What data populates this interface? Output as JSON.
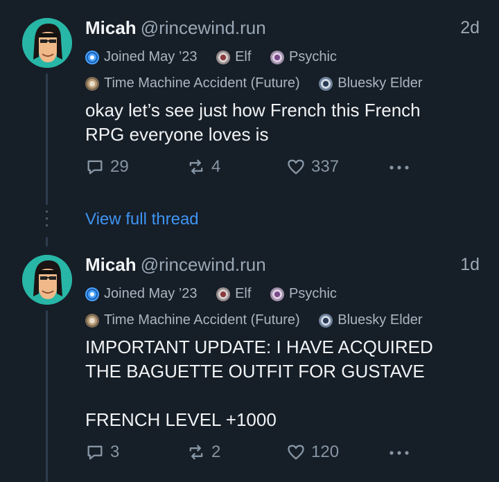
{
  "posts": [
    {
      "author_name": "Micah",
      "handle": "@rincewind.run",
      "time": "2d",
      "badges_row1": [
        {
          "label": "Joined May ’23",
          "icon": "globe-badge-icon",
          "color": "#4aa3ff"
        },
        {
          "label": "Elf",
          "icon": "elf-badge-icon",
          "color": "#c9c2c2"
        },
        {
          "label": "Psychic",
          "icon": "psychic-badge-icon",
          "color": "#c9b6d3"
        }
      ],
      "badges_row2": [
        {
          "label": "Time Machine Accident (Future)",
          "icon": "time-machine-badge-icon",
          "color": "#c8b59a"
        },
        {
          "label": "Bluesky Elder",
          "icon": "bluesky-elder-badge-icon",
          "color": "#9bb0c8"
        }
      ],
      "text": "okay let’s see just how French this French\nRPG everyone loves is",
      "replies": "29",
      "reposts": "4",
      "likes": "337"
    },
    {
      "author_name": "Micah",
      "handle": "@rincewind.run",
      "time": "1d",
      "badges_row1": [
        {
          "label": "Joined May ’23",
          "icon": "globe-badge-icon",
          "color": "#4aa3ff"
        },
        {
          "label": "Elf",
          "icon": "elf-badge-icon",
          "color": "#c9c2c2"
        },
        {
          "label": "Psychic",
          "icon": "psychic-badge-icon",
          "color": "#c9b6d3"
        }
      ],
      "badges_row2": [
        {
          "label": "Time Machine Accident (Future)",
          "icon": "time-machine-badge-icon",
          "color": "#c8b59a"
        },
        {
          "label": "Bluesky Elder",
          "icon": "bluesky-elder-badge-icon",
          "color": "#9bb0c8"
        }
      ],
      "text": "IMPORTANT UPDATE: I HAVE ACQUIRED\nTHE BAGUETTE OUTFIT FOR GUSTAVE\n\nFRENCH LEVEL +1000",
      "replies": "3",
      "reposts": "2",
      "likes": "120"
    }
  ],
  "view_thread_label": "View full thread",
  "colors": {
    "background": "#161e27",
    "link": "#3f94f5",
    "muted": "#8796a5"
  }
}
